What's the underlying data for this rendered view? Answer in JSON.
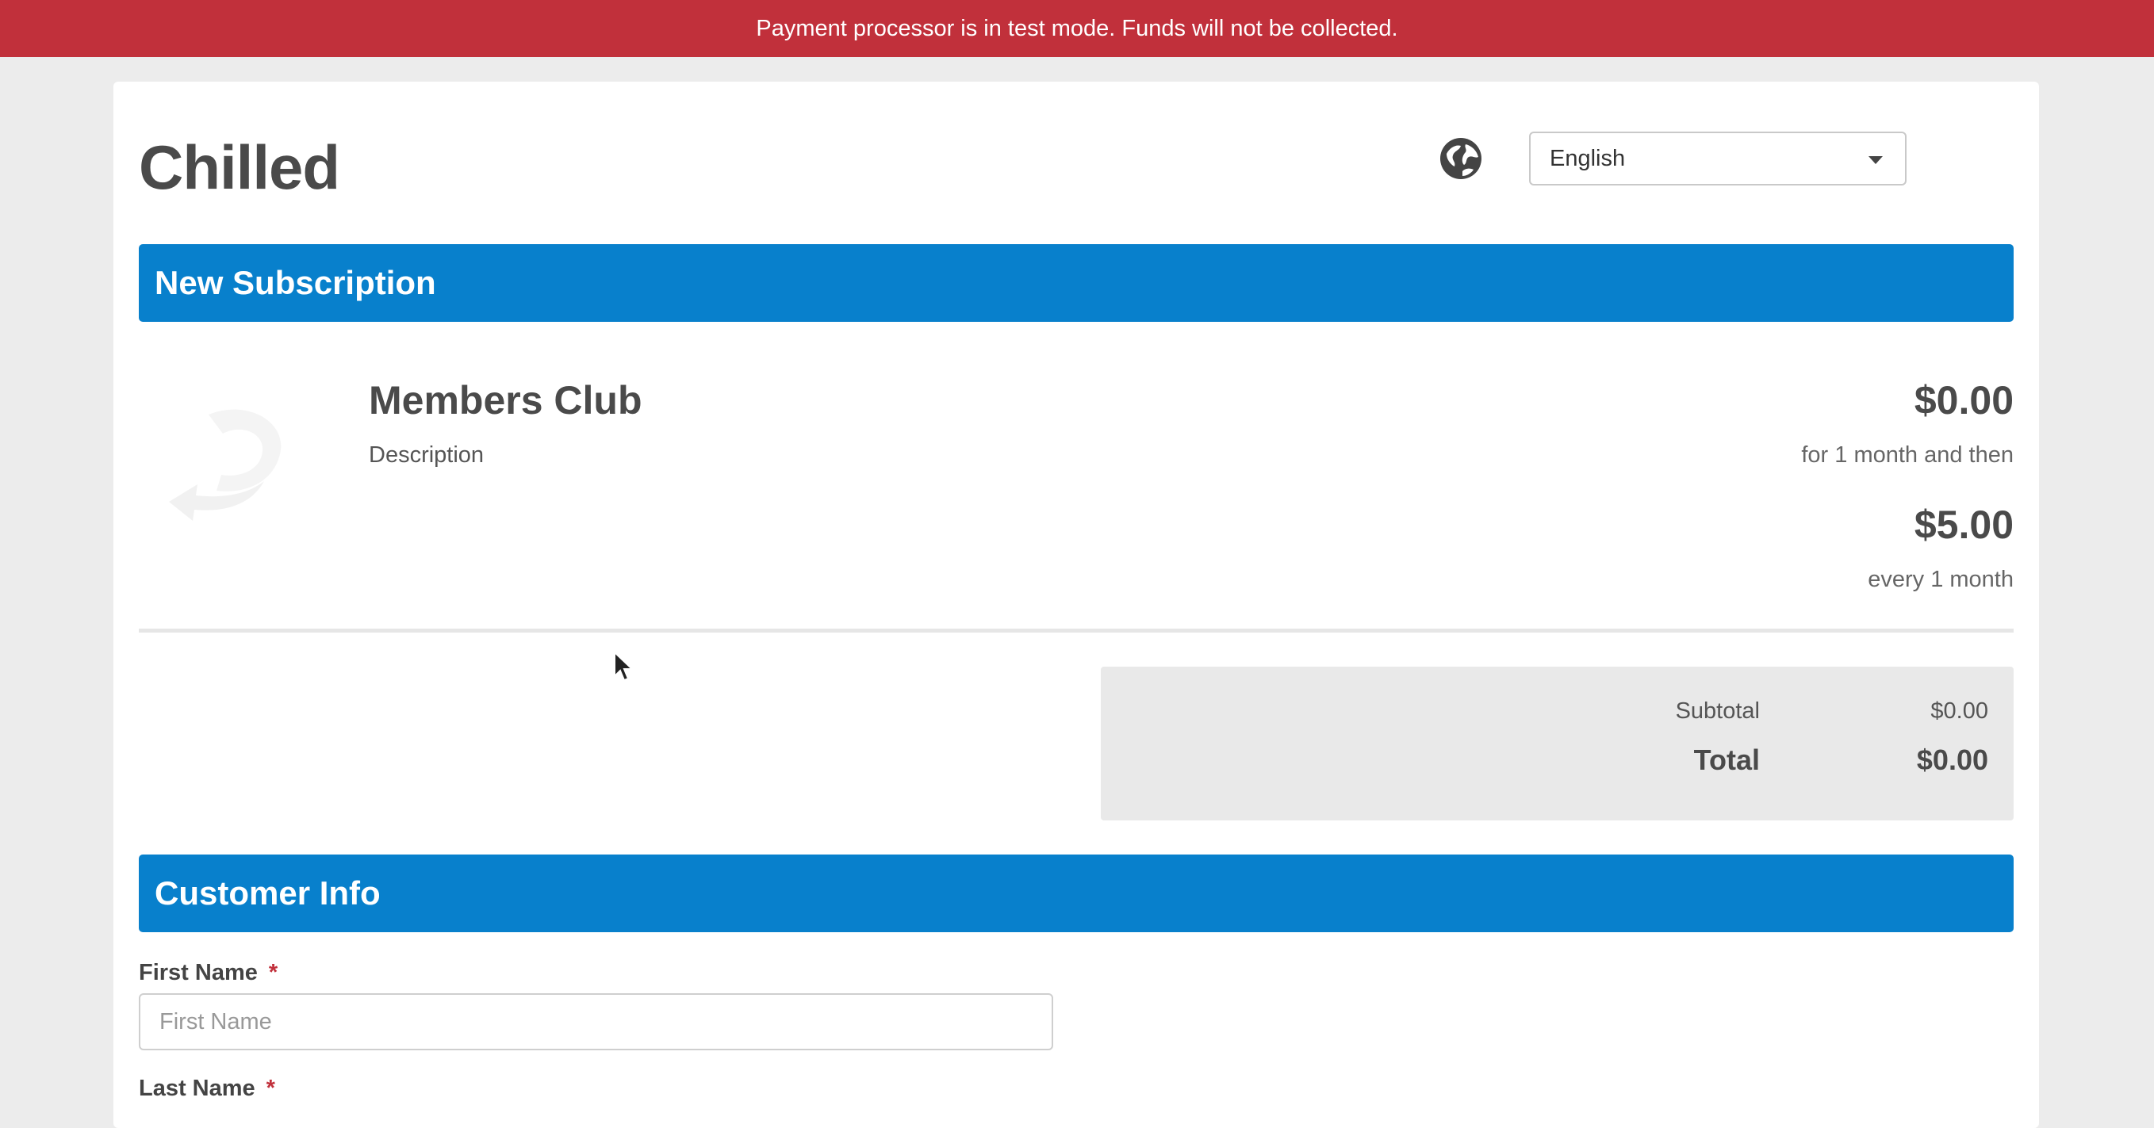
{
  "banner": {
    "text": "Payment processor is in test mode. Funds will not be collected."
  },
  "header": {
    "store_title": "Chilled",
    "globe_icon": "globe-icon",
    "language": {
      "selected": "English"
    }
  },
  "subscription": {
    "section_title": "New Subscription",
    "product": {
      "name": "Members Club",
      "description": "Description",
      "intro_price": "$0.00",
      "intro_note": "for 1 month and then",
      "recurring_price": "$5.00",
      "recurring_note": "every 1 month"
    },
    "totals": {
      "subtotal_label": "Subtotal",
      "subtotal_value": "$0.00",
      "total_label": "Total",
      "total_value": "$0.00"
    }
  },
  "customer_info": {
    "section_title": "Customer Info",
    "first_name": {
      "label": "First Name",
      "required_mark": "*",
      "placeholder": "First Name",
      "value": ""
    },
    "last_name": {
      "label": "Last Name",
      "required_mark": "*"
    }
  },
  "colors": {
    "banner": "#c1303b",
    "section_header": "#0880cc",
    "required": "#c1303b"
  }
}
